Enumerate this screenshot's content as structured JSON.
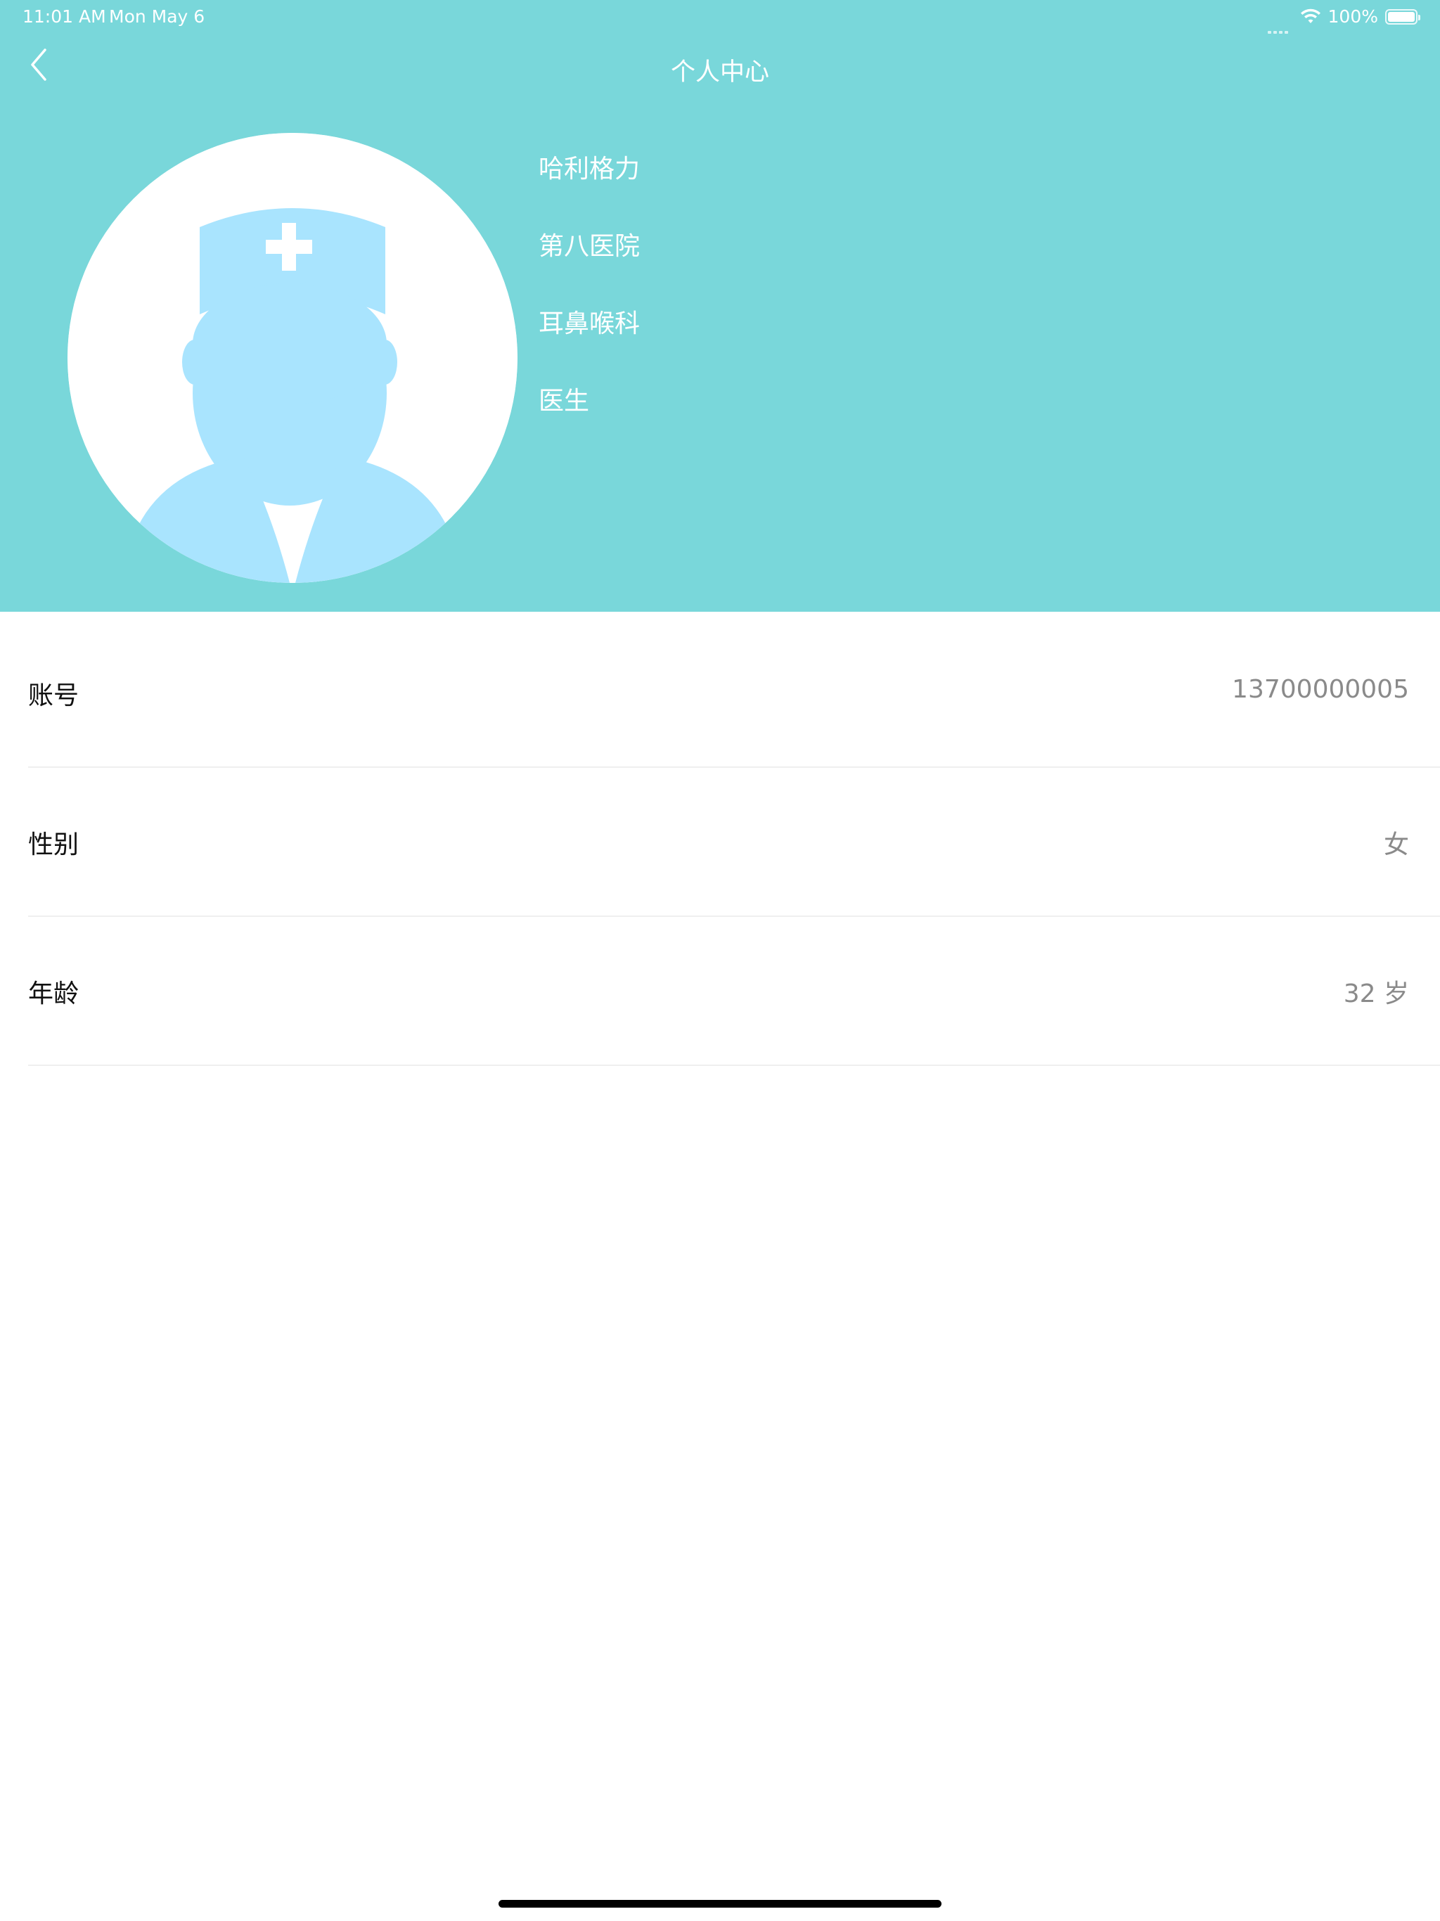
{
  "status_bar": {
    "time": "11:01 AM",
    "date": "Mon May 6",
    "battery": "100%"
  },
  "nav": {
    "title": "个人中心",
    "back_icon": "chevron-left-icon"
  },
  "profile": {
    "avatar_icon": "doctor-avatar-icon",
    "name": "哈利格力",
    "hospital": "第八医院",
    "department": "耳鼻喉科",
    "title": "医生"
  },
  "info": {
    "rows": [
      {
        "label": "账号",
        "value": "13700000005"
      },
      {
        "label": "性别",
        "value": "女"
      },
      {
        "label": "年龄",
        "value": "32 岁"
      }
    ]
  },
  "colors": {
    "header_bg": "#79D7DA",
    "avatar_figure": "#A9E4FE",
    "value_text": "#8A8A8A"
  }
}
